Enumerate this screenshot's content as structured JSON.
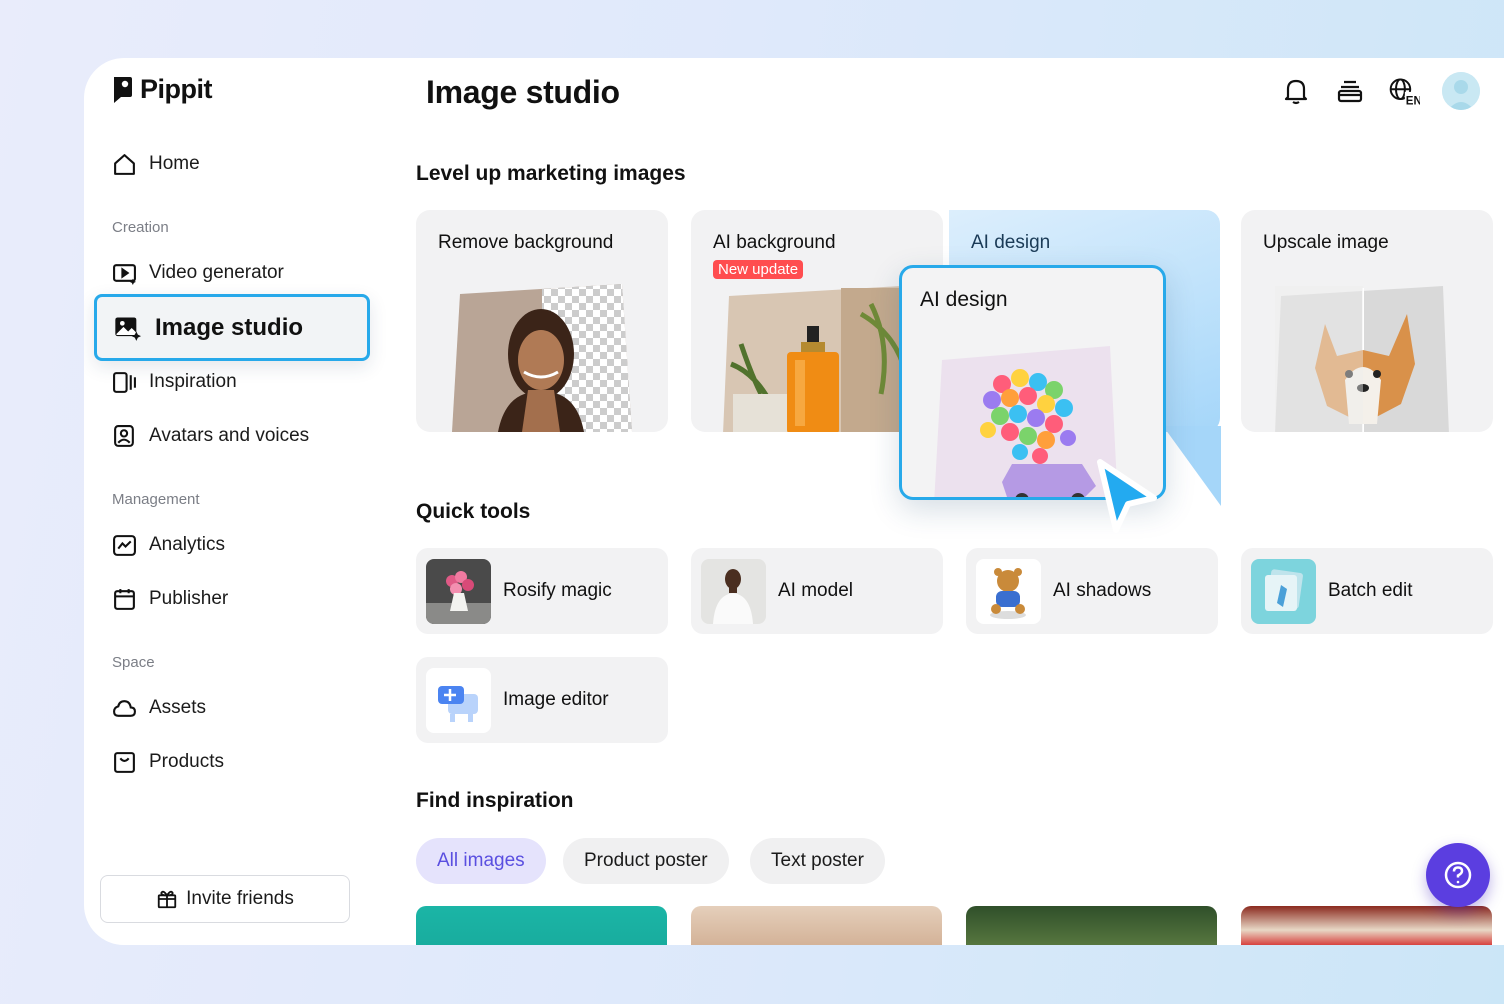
{
  "app": {
    "name": "Pippit"
  },
  "sidebar": {
    "home": "Home",
    "sections": {
      "creation": "Creation",
      "management": "Management",
      "space": "Space"
    },
    "items": {
      "video_generator": "Video generator",
      "image_studio": "Image studio",
      "inspiration": "Inspiration",
      "avatars_voices": "Avatars and voices",
      "analytics": "Analytics",
      "publisher": "Publisher",
      "assets": "Assets",
      "products": "Products"
    },
    "invite": "Invite friends"
  },
  "header": {
    "title": "Image studio",
    "language": "EN",
    "icons": [
      "bell-icon",
      "layers-icon",
      "globe-icon",
      "avatar"
    ]
  },
  "marketing": {
    "heading": "Level up marketing images",
    "cards": [
      {
        "title": "Remove background"
      },
      {
        "title": "AI background",
        "badge": "New update"
      },
      {
        "title": "AI design",
        "popup_title": "AI design"
      },
      {
        "title": "Upscale image"
      }
    ]
  },
  "quick_tools": {
    "heading": "Quick tools",
    "items": [
      "Rosify magic",
      "AI model",
      "AI shadows",
      "Batch edit",
      "Image editor"
    ]
  },
  "inspiration": {
    "heading": "Find inspiration",
    "filters": [
      "All images",
      "Product poster",
      "Text poster"
    ],
    "active_filter": "All images"
  },
  "colors": {
    "accent_border": "#27a9ea",
    "help_button": "#5b3ee0",
    "active_chip_bg": "#e5e3fc",
    "active_chip_text": "#5a4fe0",
    "badge": "#ff4d4f"
  }
}
